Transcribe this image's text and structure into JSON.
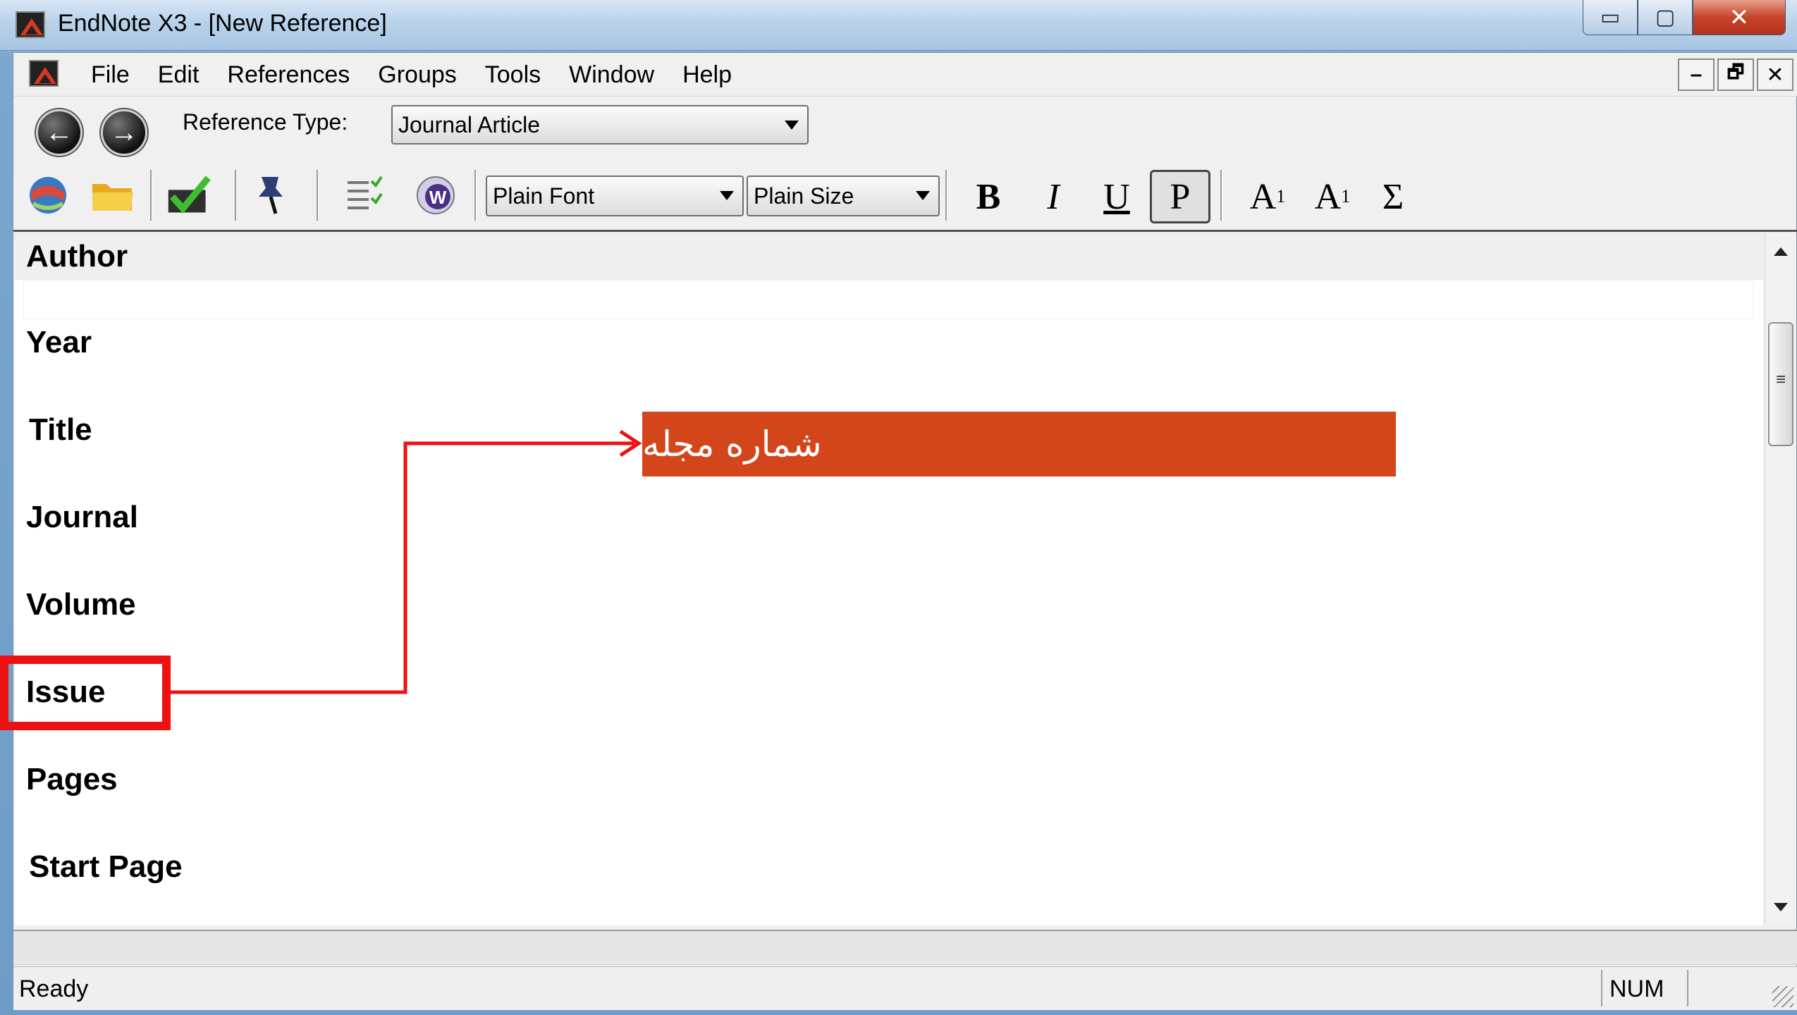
{
  "window": {
    "title": "EndNote X3 - [New Reference]",
    "caption_buttons": {
      "minimize": "▭",
      "maximize": "▢",
      "close": "✕"
    }
  },
  "menu": {
    "items": [
      {
        "label": "File"
      },
      {
        "label": "Edit"
      },
      {
        "label": "References"
      },
      {
        "label": "Groups"
      },
      {
        "label": "Tools"
      },
      {
        "label": "Window"
      },
      {
        "label": "Help"
      }
    ],
    "mdi_buttons": {
      "minimize": "–",
      "restore": "🗗",
      "close": "✕"
    }
  },
  "reference_type": {
    "label": "Reference Type:",
    "value": "Journal Article"
  },
  "toolbar": {
    "font_value": "Plain Font",
    "size_value": "Plain Size",
    "bold": "B",
    "italic": "I",
    "underline": "U",
    "plain": "P",
    "superscript": "A",
    "superscript_mark": "1",
    "subscript": "A",
    "subscript_mark": "1",
    "symbol": "Σ"
  },
  "fields": [
    {
      "label": "Author"
    },
    {
      "label": "Year"
    },
    {
      "label": "Title"
    },
    {
      "label": "Journal"
    },
    {
      "label": "Volume"
    },
    {
      "label": "Issue"
    },
    {
      "label": "Pages"
    },
    {
      "label": "Start Page"
    }
  ],
  "status": {
    "text": "Ready",
    "num": "NUM"
  },
  "annotation": {
    "callout_text": "شماره مجله",
    "callout_color": "#d3461b",
    "highlight_color": "#ee1111"
  }
}
